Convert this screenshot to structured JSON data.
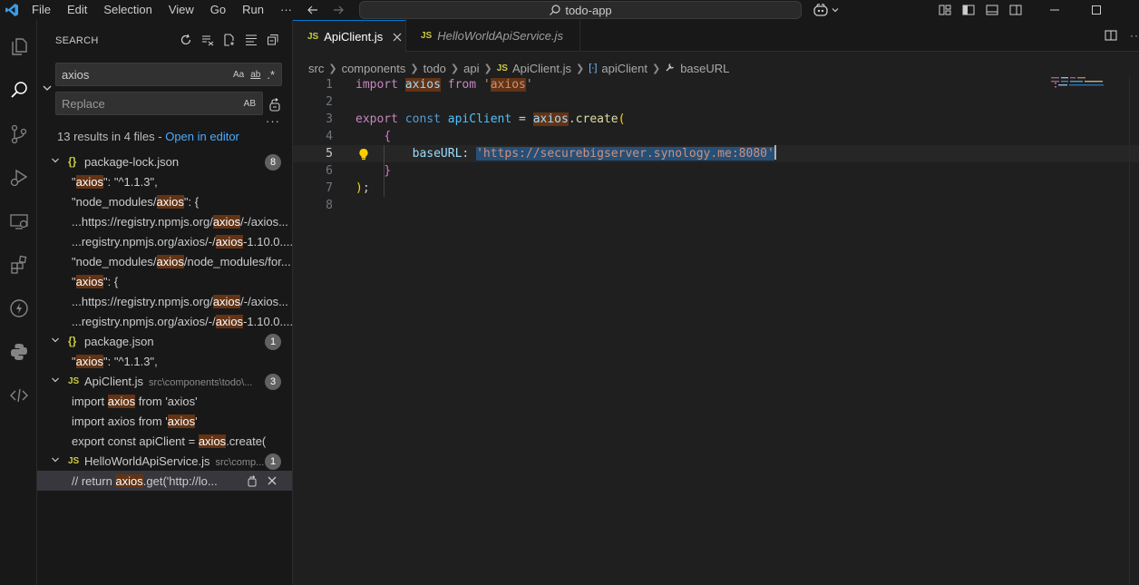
{
  "menu": {
    "items": [
      "File",
      "Edit",
      "Selection",
      "View",
      "Go",
      "Run",
      "···"
    ]
  },
  "titlebar": {
    "search_text": "todo-app"
  },
  "sidebar": {
    "title": "SEARCH",
    "search_value": "axios",
    "replace_placeholder": "Replace",
    "search_opts": [
      "Aa",
      "ab",
      ".*"
    ],
    "replace_opt": "AB",
    "more": "···",
    "summary_text": "13 results in 4 files - ",
    "summary_link": "Open in editor",
    "files": [
      {
        "name": "package-lock.json",
        "icon": "{}",
        "path": "",
        "count": "8",
        "matches": [
          [
            "\"",
            "axios",
            "\": \"^1.1.3\","
          ],
          [
            "\"node_modules/",
            "axios",
            "\": {"
          ],
          [
            "...https://registry.npmjs.org/",
            "axios",
            "/-/axios..."
          ],
          [
            "...registry.npmjs.org/axios/-/",
            "axios",
            "-1.10.0...."
          ],
          [
            "\"node_modules/",
            "axios",
            "/node_modules/for..."
          ],
          [
            "\"",
            "axios",
            "\": {"
          ],
          [
            "...https://registry.npmjs.org/",
            "axios",
            "/-/axios..."
          ],
          [
            "...registry.npmjs.org/axios/-/",
            "axios",
            "-1.10.0...."
          ]
        ]
      },
      {
        "name": "package.json",
        "icon": "{}",
        "path": "",
        "count": "1",
        "matches": [
          [
            "\"",
            "axios",
            "\": \"^1.1.3\","
          ]
        ]
      },
      {
        "name": "ApiClient.js",
        "icon": "JS",
        "path": "src\\components\\todo\\...",
        "count": "3",
        "matches": [
          [
            "import ",
            "axios",
            " from 'axios'"
          ],
          [
            "import axios from '",
            "axios",
            "'"
          ],
          [
            "export const apiClient = ",
            "axios",
            ".create("
          ]
        ]
      },
      {
        "name": "HelloWorldApiService.js",
        "icon": "JS",
        "path": "src\\comp...",
        "count": "1",
        "matches": [
          [
            "//      return ",
            "axios",
            ".get('http://lo..."
          ]
        ]
      }
    ]
  },
  "editor": {
    "tabs": [
      {
        "label": "ApiClient.js",
        "active": true
      },
      {
        "label": "HelloWorldApiService.js",
        "active": false
      }
    ],
    "breadcrumb": [
      "src",
      "components",
      "todo",
      "api",
      "ApiClient.js",
      "apiClient",
      "baseURL"
    ],
    "lines": [
      {
        "n": "1",
        "tokens": [
          [
            "kw",
            "import"
          ],
          [
            "",
            " "
          ],
          [
            "var hl",
            "axios"
          ],
          [
            "",
            " "
          ],
          [
            "kw",
            "from"
          ],
          [
            "",
            " "
          ],
          [
            "str",
            "'"
          ],
          [
            "str hl",
            "axios"
          ],
          [
            "str",
            "'"
          ]
        ]
      },
      {
        "n": "2",
        "tokens": []
      },
      {
        "n": "3",
        "tokens": [
          [
            "kw",
            "export"
          ],
          [
            "",
            " "
          ],
          [
            "kw2",
            "const"
          ],
          [
            "",
            " "
          ],
          [
            "cn",
            "apiClient"
          ],
          [
            "",
            " = "
          ],
          [
            "var hl",
            "axios"
          ],
          [
            "",
            "."
          ],
          [
            "fn",
            "create"
          ],
          [
            "br1",
            "("
          ]
        ]
      },
      {
        "n": "4",
        "tokens": [
          [
            "",
            "    "
          ],
          [
            "br2",
            "{"
          ]
        ]
      },
      {
        "n": "5",
        "tokens": [
          [
            "",
            "        "
          ],
          [
            "prop",
            "baseURL"
          ],
          [
            "",
            ": "
          ],
          [
            "str sel-str",
            "'https://securebigserver.synology.me:8080'"
          ]
        ]
      },
      {
        "n": "6",
        "tokens": [
          [
            "",
            "    "
          ],
          [
            "br2",
            "}"
          ]
        ]
      },
      {
        "n": "7",
        "tokens": [
          [
            "br1",
            ")"
          ],
          [
            "",
            ";"
          ]
        ]
      },
      {
        "n": "8",
        "tokens": []
      }
    ],
    "current_line": "5"
  }
}
